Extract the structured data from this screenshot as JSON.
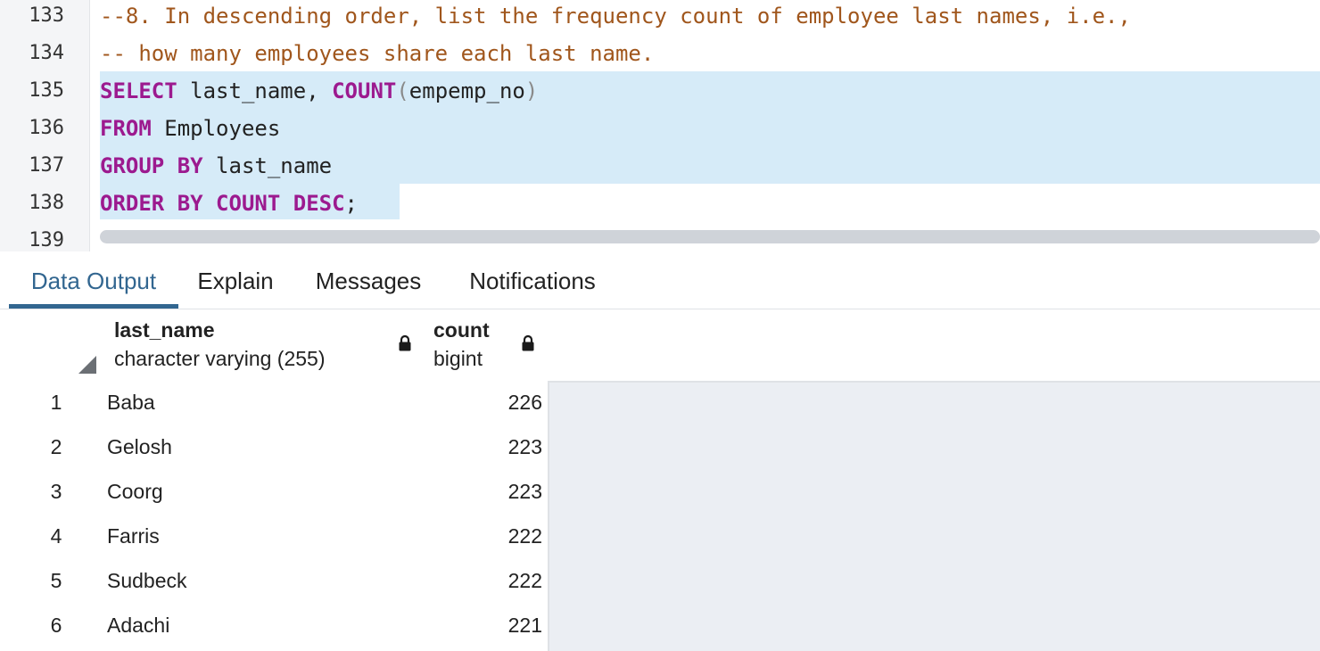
{
  "editor": {
    "lines": [
      {
        "num": "133",
        "comment": "--8. In descending order, list the frequency count of employee last names, i.e.,"
      },
      {
        "num": "134",
        "comment": "-- how many employees share each last name."
      },
      {
        "num": "135",
        "kw1": "SELECT",
        "text1": " last_name, ",
        "kw2": "COUNT",
        "punc1": "(",
        "text2": "empemp_no",
        "punc2": ")"
      },
      {
        "num": "136",
        "kw1": "FROM",
        "text1": " Employees"
      },
      {
        "num": "137",
        "kw1": "GROUP BY",
        "text1": " last_name"
      },
      {
        "num": "138",
        "kw1": "ORDER BY COUNT DESC",
        "text1": ";"
      },
      {
        "num": "139"
      }
    ]
  },
  "tabs": [
    {
      "label": "Data Output",
      "active": true
    },
    {
      "label": "Explain"
    },
    {
      "label": "Messages"
    },
    {
      "label": "Notifications"
    }
  ],
  "grid": {
    "columns": [
      {
        "name": "last_name",
        "type": "character varying (255)"
      },
      {
        "name": "count",
        "type": "bigint"
      }
    ],
    "rows": [
      {
        "num": "1",
        "last_name": "Baba",
        "count": "226"
      },
      {
        "num": "2",
        "last_name": "Gelosh",
        "count": "223"
      },
      {
        "num": "3",
        "last_name": "Coorg",
        "count": "223"
      },
      {
        "num": "4",
        "last_name": "Farris",
        "count": "222"
      },
      {
        "num": "5",
        "last_name": "Sudbeck",
        "count": "222"
      },
      {
        "num": "6",
        "last_name": "Adachi",
        "count": "221"
      }
    ]
  },
  "colors": {
    "keyword": "#9c1a8f",
    "comment": "#a0561c",
    "selection": "#d6ebf8",
    "active_tab": "#326690"
  }
}
